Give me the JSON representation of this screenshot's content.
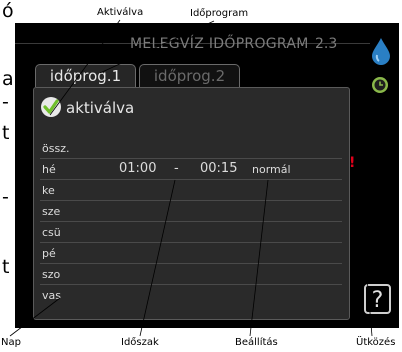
{
  "callouts": {
    "aktivalva": "Aktiválva",
    "idoprogram": "Időprogram",
    "nap": "Nap",
    "idoszak": "Időszak",
    "beallitas": "Beállítás",
    "utkozes": "Ütközés"
  },
  "doc_text": {
    "frag1": "ó",
    "frag2": "a",
    "frag3": "-",
    "frag4": "t",
    "frag5": "-",
    "frag6": "t"
  },
  "screen": {
    "title": "MELEGVÍZ IDŐPROGRAM",
    "number": "2.3",
    "tabs": [
      {
        "label": "időprog.1",
        "active": true
      },
      {
        "label": "időprog.2",
        "active": false
      }
    ],
    "activated_label": "aktiválva",
    "activated_checked": true,
    "rows": [
      {
        "day": "össz.",
        "start": "",
        "end": "",
        "mode": ""
      },
      {
        "day": "hé",
        "start": "01:00",
        "end": "00:15",
        "mode": "normál"
      },
      {
        "day": "ke",
        "start": "",
        "end": "",
        "mode": ""
      },
      {
        "day": "sze",
        "start": "",
        "end": "",
        "mode": ""
      },
      {
        "day": "csü",
        "start": "",
        "end": "",
        "mode": ""
      },
      {
        "day": "pé",
        "start": "",
        "end": "",
        "mode": ""
      },
      {
        "day": "szo",
        "start": "",
        "end": "",
        "mode": ""
      },
      {
        "day": "vas",
        "start": "",
        "end": "",
        "mode": ""
      }
    ],
    "time_separator": "-",
    "conflict_mark": "!",
    "help_label": "?"
  },
  "colors": {
    "screen_bg": "#000000",
    "panel_bg": "#2a2a2a",
    "check_green": "#6fbf2a",
    "drop_blue": "#2a7fc4",
    "clock_green": "#8ab84a",
    "conflict_red": "#e0001b"
  },
  "icons": [
    "check-icon",
    "water-drop-icon",
    "clock-icon",
    "help-icon"
  ]
}
